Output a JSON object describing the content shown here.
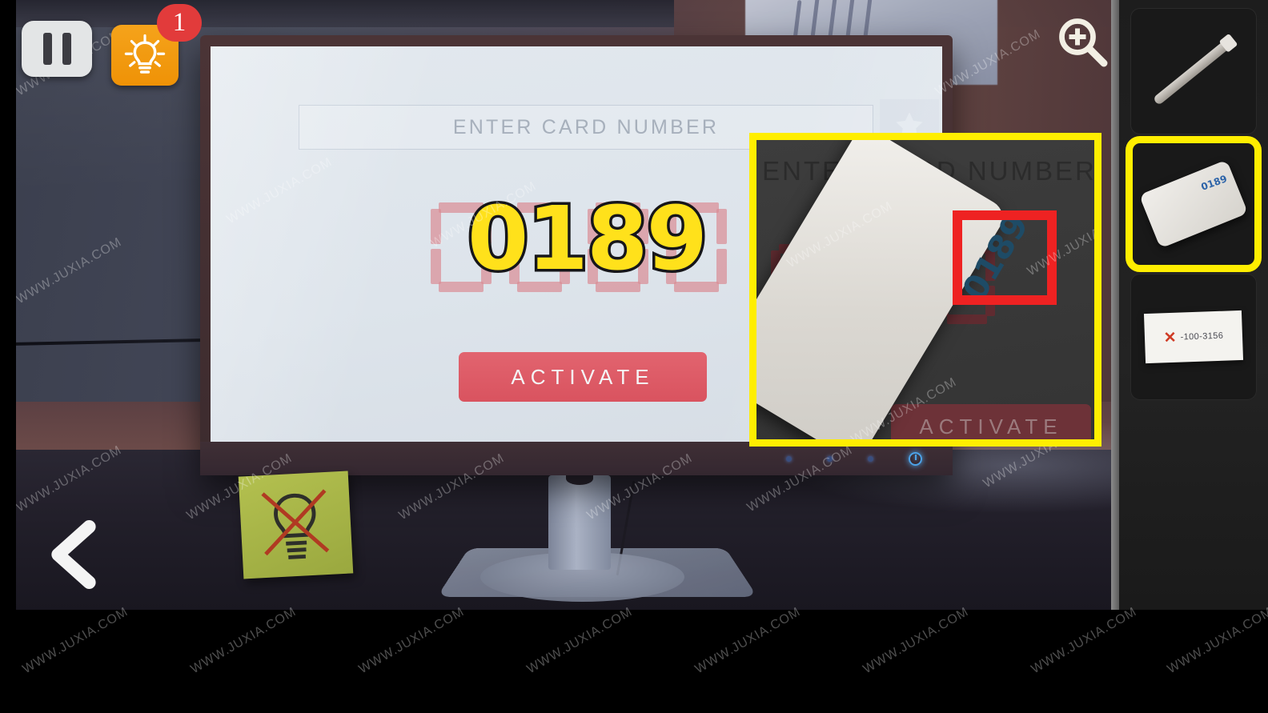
{
  "hud": {
    "pause_label": "pause-button",
    "hint_label": "hint-button",
    "hint_badge_count": "1",
    "back_label": "back-button",
    "magnifier_label": "zoom-in"
  },
  "screen": {
    "card_input_placeholder": "ENTER CARD NUMBER",
    "card_input_value": "",
    "star_button_label": "favorite",
    "display_digits": [
      "",
      "",
      "",
      ""
    ],
    "activate_label": "ACTIVATE",
    "annotation_code": "0189"
  },
  "inset": {
    "placeholder_text": "ENTER CARD NUMBER",
    "activate_label": "ACTIVATE",
    "card_number": "0189"
  },
  "inventory": {
    "slots": [
      {
        "name": "metal-rod",
        "label": "",
        "selected": false
      },
      {
        "name": "keycard",
        "label": "0189",
        "selected": true
      },
      {
        "name": "paper-note",
        "label_x": "✕",
        "label_text": "-100-3156",
        "selected": false
      }
    ]
  },
  "sticky_note": {
    "icon": "crossed-out-lightbulb"
  },
  "colors": {
    "highlight": "#ffee00",
    "accent_red": "#ee2222",
    "activate": "#d9535f",
    "hint_orange": "#ef9206",
    "badge_red": "#e23b3b",
    "annotation_yellow": "#ffe11b"
  },
  "watermark": {
    "text": "WWW.JUXIA.COM"
  }
}
